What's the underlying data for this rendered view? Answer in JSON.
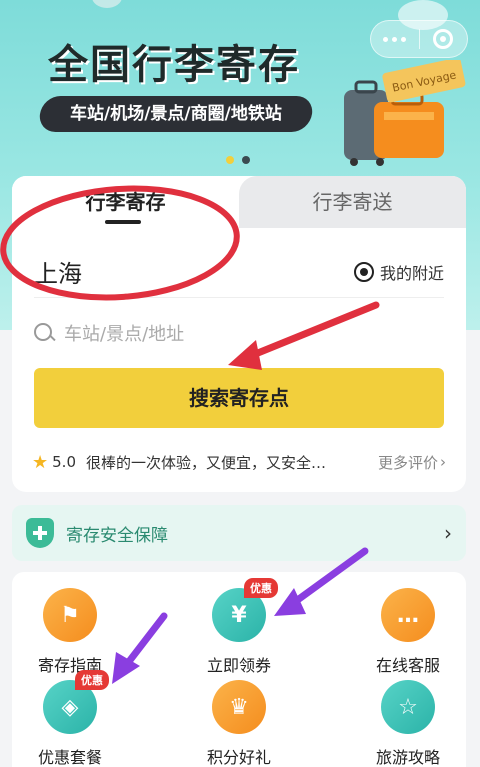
{
  "banner": {
    "title": "全国行李寄存",
    "subtitle": "车站/机场/景点/商圈/地铁站",
    "suitcase_text": "Bon Voyage",
    "dots": [
      "#f2cf3c",
      "#3a4a50"
    ]
  },
  "capsule": {
    "more_icon": "more-dots-icon",
    "close_icon": "target-icon"
  },
  "tabs": [
    {
      "label": "行李寄存",
      "active": true
    },
    {
      "label": "行李寄送",
      "active": false
    }
  ],
  "location": {
    "city": "上海",
    "nearby_label": "我的附近"
  },
  "search": {
    "placeholder": "车站/景点/地址",
    "button_label": "搜索寄存点"
  },
  "rating": {
    "score": "5.0",
    "review": "很棒的一次体验，又便宜，又安全…",
    "more_label": "更多评价"
  },
  "safety": {
    "label": "寄存安全保障"
  },
  "grid": [
    {
      "label": "寄存指南",
      "icon": "signpost-icon",
      "style": "orange",
      "glyph": "⚑"
    },
    {
      "label": "立即领券",
      "icon": "coupon-icon",
      "style": "teal",
      "glyph": "¥",
      "badge": "优惠"
    },
    {
      "label": "在线客服",
      "icon": "chat-icon",
      "style": "orange",
      "glyph": "…"
    },
    {
      "label": "优惠套餐",
      "icon": "tag-icon",
      "style": "teal",
      "glyph": "◈",
      "badge": "优惠"
    },
    {
      "label": "积分好礼",
      "icon": "crown-icon",
      "style": "orange",
      "glyph": "♛"
    },
    {
      "label": "旅游攻略",
      "icon": "book-icon",
      "style": "teal",
      "glyph": "☆"
    }
  ],
  "colors": {
    "accent_yellow": "#f2cf3c",
    "teal": "#2bb3a8",
    "annotation_red": "#e0303e",
    "annotation_purple": "#8a3ee0"
  }
}
